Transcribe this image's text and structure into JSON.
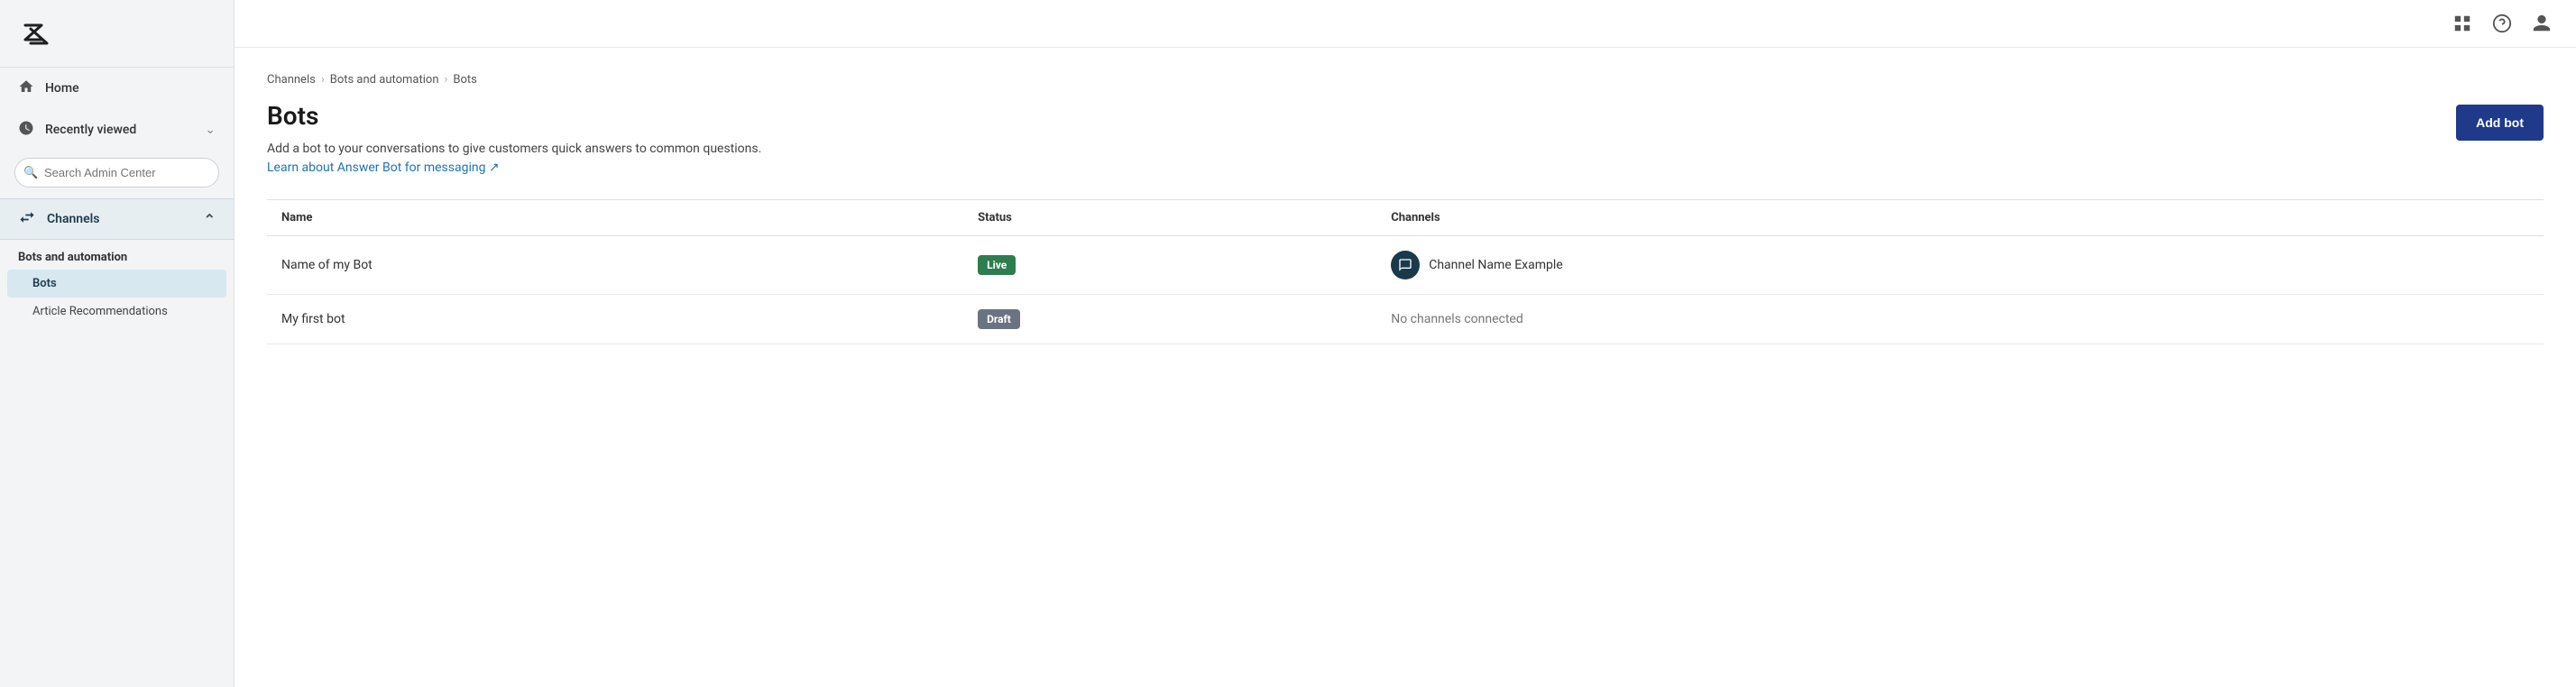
{
  "logo": {
    "alt": "Zendesk logo"
  },
  "sidebar": {
    "home_label": "Home",
    "recently_viewed_label": "Recently viewed",
    "search_placeholder": "Search Admin Center",
    "channels_label": "Channels",
    "bots_section_title": "Bots and automation",
    "bots_sub_items": [
      {
        "label": "Bots",
        "active": true
      },
      {
        "label": "Article Recommendations",
        "active": false
      }
    ]
  },
  "topbar": {
    "grid_icon": "⊞",
    "help_icon": "?",
    "user_icon": "👤"
  },
  "breadcrumb": {
    "items": [
      "Channels",
      "Bots and automation",
      "Bots"
    ]
  },
  "page": {
    "title": "Bots",
    "description": "Add a bot to your conversations to give customers quick answers to common questions.",
    "learn_more_text": "Learn about Answer Bot for messaging ↗",
    "add_bot_label": "Add bot"
  },
  "table": {
    "columns": [
      "Name",
      "Status",
      "Channels"
    ],
    "rows": [
      {
        "name": "Name of my Bot",
        "status": "Live",
        "status_type": "live",
        "channel": "Channel Name Example",
        "has_channel_icon": true
      },
      {
        "name": "My first bot",
        "status": "Draft",
        "status_type": "draft",
        "channel": "No channels connected",
        "has_channel_icon": false
      }
    ]
  }
}
